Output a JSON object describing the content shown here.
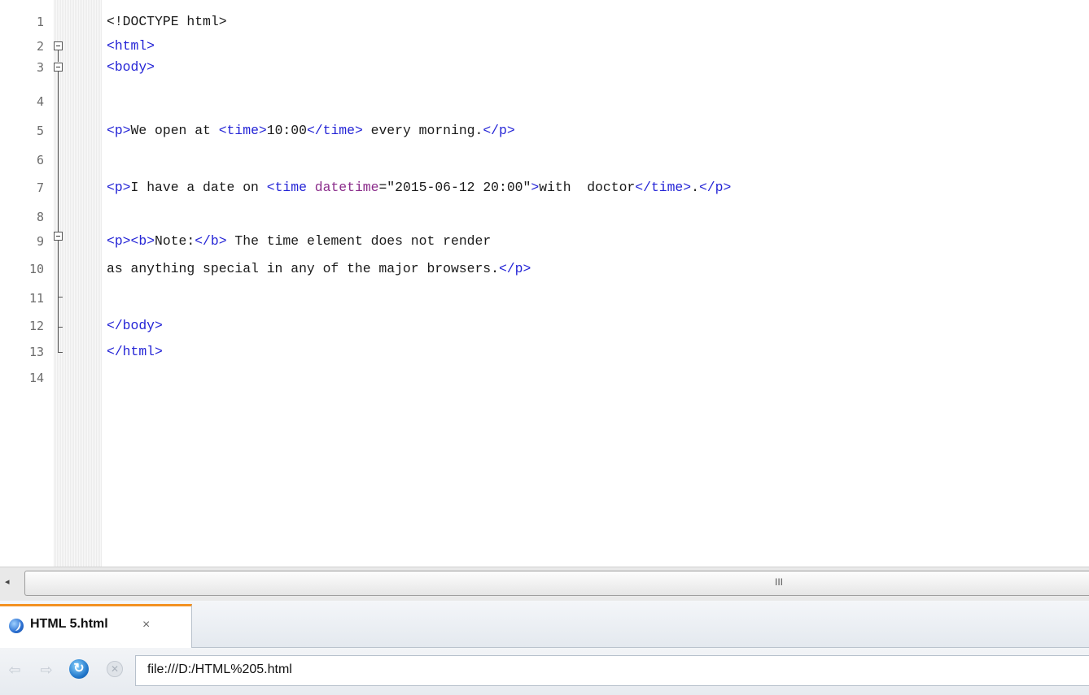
{
  "editor": {
    "lines": [
      {
        "n": "1"
      },
      {
        "n": "2"
      },
      {
        "n": "3"
      },
      {
        "n": "4"
      },
      {
        "n": "5"
      },
      {
        "n": "6"
      },
      {
        "n": "7"
      },
      {
        "n": "8"
      },
      {
        "n": "9"
      },
      {
        "n": "10"
      },
      {
        "n": "11"
      },
      {
        "n": "12"
      },
      {
        "n": "13"
      },
      {
        "n": "14"
      }
    ],
    "code": {
      "l1": "<!DOCTYPE html>",
      "l2_tag": "<html>",
      "l3_tag": "<body>",
      "l5_open": "<p>",
      "l5_text1": "We open at ",
      "l5_time_open": "<time>",
      "l5_time_val": "10:00",
      "l5_time_close": "</time>",
      "l5_text2": " every morning.",
      "l5_close": "</p>",
      "l7_open": "<p>",
      "l7_text1": "I have a date on ",
      "l7_time_open": "<time ",
      "l7_attr": "datetime",
      "l7_eq": "=\"2015-06-12 20:00\"",
      "l7_gt": ">",
      "l7_text2": "with  doctor",
      "l7_time_close": "</time>",
      "l7_dot": ".",
      "l7_close": "</p>",
      "l9_p": "<p>",
      "l9_b": "<b>",
      "l9_note": "Note:",
      "l9_b_close": "</b>",
      "l9_text": " The time element does not render",
      "l10_text": "as anything special in any of the major browsers.",
      "l10_close": "</p>",
      "l12_tag": "</body>",
      "l13_tag": "</html>"
    }
  },
  "scrollbar": {
    "left_arrow": "◂",
    "grip": "III"
  },
  "preview": {
    "tab_label": "HTML 5.html",
    "tab_close": "×",
    "url": "file:///D:/HTML%205.html"
  },
  "icons": {
    "back": "arrow-left-icon",
    "forward": "arrow-right-icon",
    "reload": "reload-icon",
    "stop": "stop-icon",
    "tab": "browser-globe-icon"
  },
  "colors": {
    "tag": "#2424d6",
    "attr": "#8b2d8b",
    "accent": "#f39222"
  }
}
